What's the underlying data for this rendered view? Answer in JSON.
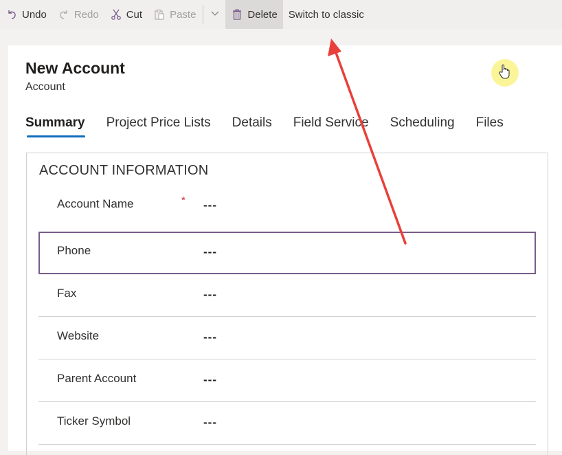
{
  "toolbar": {
    "undo": "Undo",
    "redo": "Redo",
    "cut": "Cut",
    "paste": "Paste",
    "delete": "Delete",
    "switch": "Switch to classic"
  },
  "header": {
    "title": "New Account",
    "entity": "Account"
  },
  "tabs": [
    "Summary",
    "Project Price Lists",
    "Details",
    "Field Service",
    "Scheduling",
    "Files"
  ],
  "section": {
    "title": "ACCOUNT INFORMATION",
    "fields": [
      {
        "label": "Account Name",
        "required": "*",
        "value": "---"
      },
      {
        "label": "Phone",
        "value": "---"
      },
      {
        "label": "Fax",
        "value": "---"
      },
      {
        "label": "Website",
        "value": "---"
      },
      {
        "label": "Parent Account",
        "value": "---"
      },
      {
        "label": "Ticker Symbol",
        "value": "---"
      }
    ]
  },
  "colors": {
    "accent": "#0f6cbd",
    "required": "#c4314b",
    "focus_border": "#7a5b8a",
    "annotation_arrow": "#e8403a",
    "cursor_highlight": "#fbf59a"
  },
  "icons": [
    "undo-icon",
    "redo-icon",
    "cut-icon",
    "paste-icon",
    "chevron-down-icon",
    "delete-icon",
    "hand-cursor-icon",
    "annotation-arrow"
  ]
}
